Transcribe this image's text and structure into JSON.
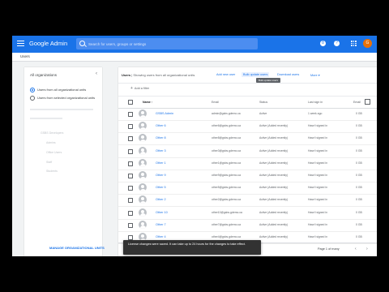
{
  "app": {
    "logo_prefix": "Google",
    "logo_product": "Admin",
    "search_placeholder": "Search for users, groups or settings",
    "avatar_letter": "G",
    "help_icon_text": "?",
    "notif_icon_text": "8"
  },
  "breadcrumb": "Users",
  "filter_panel": {
    "title": "All organizations",
    "collapse": "‹",
    "options": [
      {
        "label": "Users from all organizational units",
        "selected": true
      },
      {
        "label": "Users from selected organizational units",
        "selected": false
      }
    ],
    "tree": [
      "GSBS Developers",
      "Admins",
      "Office Users",
      "Staff",
      "Students"
    ],
    "footer": "MANAGE ORGANIZATIONAL UNITS"
  },
  "main": {
    "title_bold": "Users",
    "title_rest": "Showing users from all organizational units",
    "actions": {
      "add_new_user": "Add new user",
      "bulk_update": "Bulk update users",
      "download": "Download users",
      "more": "More"
    },
    "tooltip": "Bulk update users",
    "add_filter": "Add a filter",
    "columns": {
      "name": "Name",
      "email": "Email",
      "status": "Status",
      "last_sign_in": "Last sign in",
      "email_usage": "Email"
    },
    "rows": [
      {
        "name": "GSBS Admin",
        "email": "admin@gsbs.gdemo.ca",
        "status": "Active",
        "last_sign_in": "1 week ago",
        "usage": "0 GB"
      },
      {
        "name": "Other 6",
        "email": "other6@gsbs.gdemo.ca",
        "status": "Active (Added recently)",
        "last_sign_in": "Hasn't signed in",
        "usage": "0 GB"
      },
      {
        "name": "Other 8",
        "email": "other8@gsbs.gdemo.ca",
        "status": "Active (Added recently)",
        "last_sign_in": "Hasn't signed in",
        "usage": "0 GB"
      },
      {
        "name": "Other 3",
        "email": "other3@gsbs.gdemo.ca",
        "status": "Active (Added recently)",
        "last_sign_in": "Hasn't signed in",
        "usage": "0 GB"
      },
      {
        "name": "Other 1",
        "email": "other1@gsbs.gdemo.ca",
        "status": "Active (Added recently)",
        "last_sign_in": "Hasn't signed in",
        "usage": "0 GB"
      },
      {
        "name": "Other 9",
        "email": "other9@gsbs.gdemo.ca",
        "status": "Active (Added recently)",
        "last_sign_in": "Hasn't signed in",
        "usage": "0 GB"
      },
      {
        "name": "Other 5",
        "email": "other5@gsbs.gdemo.ca",
        "status": "Active (Added recently)",
        "last_sign_in": "Hasn't signed in",
        "usage": "0 GB"
      },
      {
        "name": "Other 2",
        "email": "other2@gsbs.gdemo.ca",
        "status": "Active (Added recently)",
        "last_sign_in": "Hasn't signed in",
        "usage": "0 GB"
      },
      {
        "name": "Other 10",
        "email": "other10@gsbs.gdemo.ca",
        "status": "Active (Added recently)",
        "last_sign_in": "Hasn't signed in",
        "usage": "0 GB"
      },
      {
        "name": "Other 7",
        "email": "other7@gsbs.gdemo.ca",
        "status": "Active (Added recently)",
        "last_sign_in": "Hasn't signed in",
        "usage": "0 GB"
      },
      {
        "name": "Other 4",
        "email": "other4@gsbs.gdemo.ca",
        "status": "Active (Added recently)",
        "last_sign_in": "Hasn't signed in",
        "usage": "0 GB"
      }
    ],
    "pager": {
      "rows_label": "Rows",
      "info": "Page 1 of many",
      "prev": "‹",
      "next": "›"
    }
  },
  "snackbar": "License changes were saved. It can take up to 24 hours for the changes to take effect.",
  "colors": {
    "appbar": "#1a73e8",
    "link": "#1a73e8",
    "avatar": "#e8710a",
    "snackbar": "#323232"
  }
}
